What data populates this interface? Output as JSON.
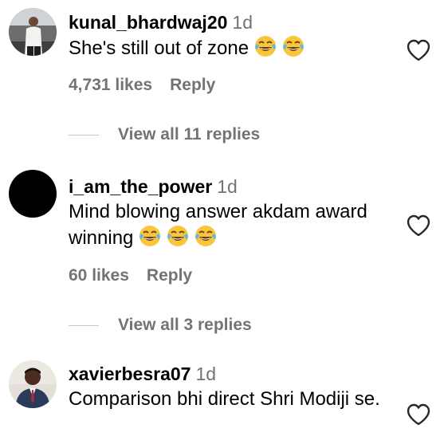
{
  "colors": {
    "primary_text": "#000000",
    "secondary_text": "#737373",
    "divider": "#c7c7c7",
    "background": "#ffffff"
  },
  "comments": [
    {
      "username": "kunal_bhardwaj20",
      "time": "1d",
      "text": "She's still out of zone",
      "emoji_count": 2,
      "emoji": "face-with-tears-of-joy",
      "likes": "4,731 likes",
      "reply_label": "Reply",
      "view_replies": "View all 11 replies"
    },
    {
      "username": "i_am_the_power",
      "time": "1d",
      "text": "Mind blowing answer akdam award winning",
      "emoji_count": 3,
      "emoji": "face-with-tears-of-joy",
      "likes": "60 likes",
      "reply_label": "Reply",
      "view_replies": "View all 3 replies"
    },
    {
      "username": "xavierbesra07",
      "time": "1d",
      "text": "Comparison bhi direct Shri Modiji se."
    }
  ],
  "icons": {
    "like": "heart-outline-icon",
    "emoji": "face-with-tears-of-joy"
  }
}
